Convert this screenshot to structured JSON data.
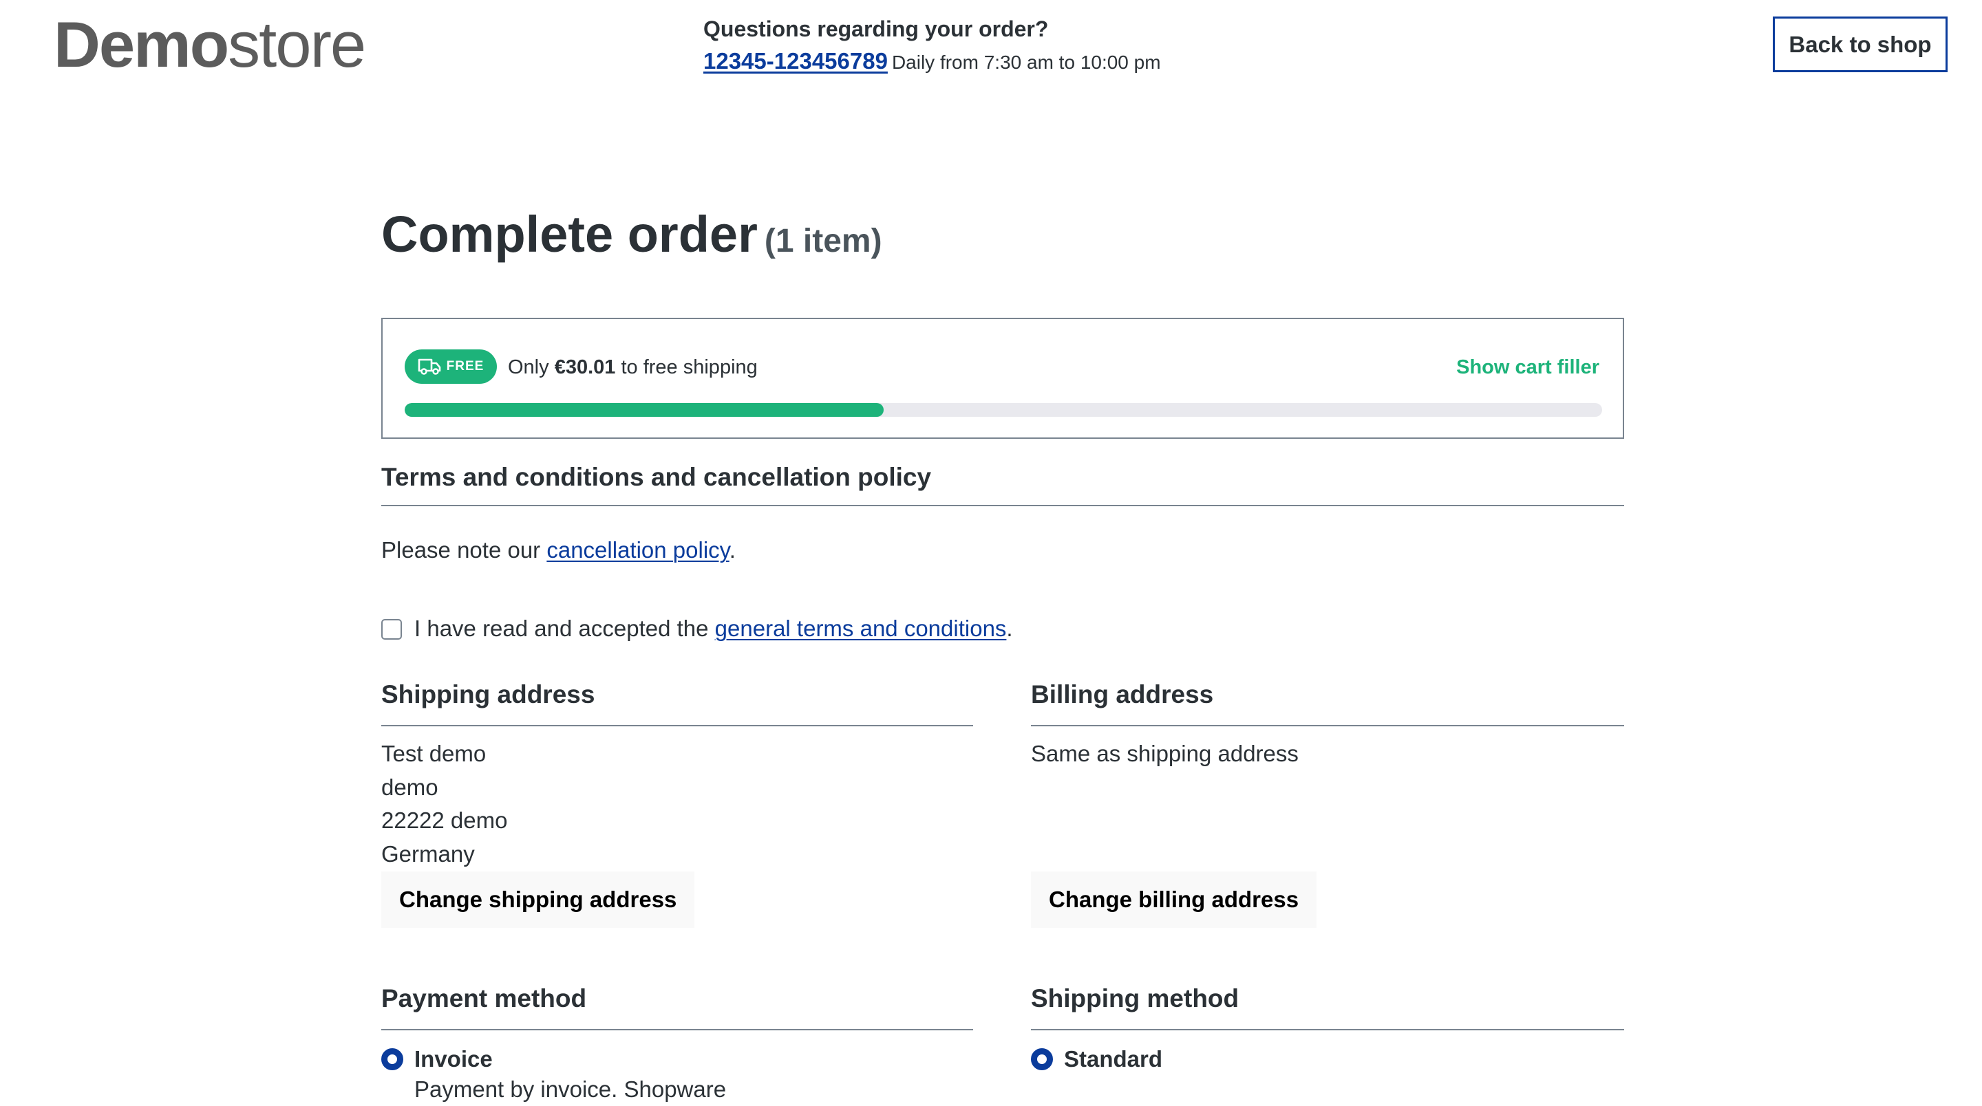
{
  "header": {
    "logo_bold": "Demo",
    "logo_light": "store",
    "hotline_title": "Questions regarding your order?",
    "hotline_phone": "12345-123456789",
    "hotline_hours": "Daily from 7:30 am to 10:00 pm",
    "back_button": "Back to shop"
  },
  "page": {
    "title": "Complete order",
    "item_count": "(1 item)"
  },
  "free_shipping": {
    "badge": "FREE",
    "badge_icon": "truck-icon",
    "prefix": "Only",
    "amount": "€30.01",
    "suffix": "to free shipping",
    "cart_filler": "Show cart filler",
    "progress_fraction": 0.4,
    "accent_color": "#1db37a"
  },
  "terms": {
    "title": "Terms and conditions and cancellation policy",
    "note_prefix": "Please note our",
    "note_link": "cancellation policy",
    "note_suffix": ".",
    "checkbox_prefix": "I have read and accepted the",
    "checkbox_link": "general terms and conditions",
    "checkbox_suffix": ".",
    "checkbox_checked": false
  },
  "shipping_address": {
    "title": "Shipping address",
    "lines": [
      "Test demo",
      "demo",
      "22222 demo",
      "Germany"
    ],
    "change_button": "Change shipping address"
  },
  "billing_address": {
    "title": "Billing address",
    "text": "Same as shipping address",
    "change_button": "Change billing address"
  },
  "payment": {
    "title": "Payment method",
    "selected": "Invoice",
    "description": "Payment by invoice. Shopware"
  },
  "shipping_method": {
    "title": "Shipping method",
    "selected": "Standard"
  },
  "colors": {
    "primary": "#0b3c9c",
    "text": "#2b3136",
    "success": "#1db37a",
    "border": "#798490"
  }
}
